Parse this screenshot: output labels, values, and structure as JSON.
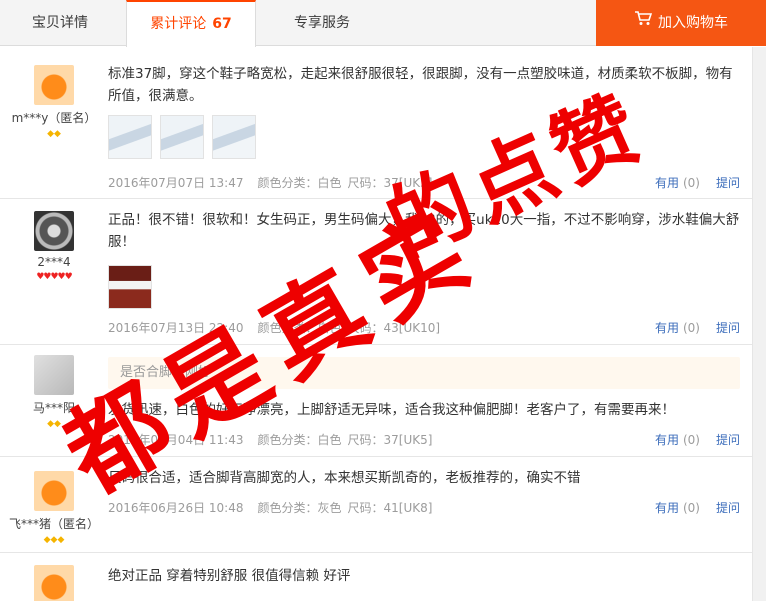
{
  "tabs": {
    "detail": "宝贝详情",
    "reviews_label": "累计评论",
    "reviews_count": "67",
    "service": "专享服务",
    "cart": "加入购物车"
  },
  "reviews": [
    {
      "nick": "m***y（匿名）",
      "rank": "◆◆",
      "text": "标准37脚，穿这个鞋子略宽松，走起来很舒服很轻，很跟脚，没有一点塑胶味道，材质柔软不板脚，物有所值，很满意。",
      "date": "2016年07月07日 13:47",
      "color": "颜色分类：白色",
      "size": "尺码：37[UK5]",
      "useful": "有用",
      "useful_n": "(0)",
      "ask": "提问"
    },
    {
      "nick": "2***4",
      "rank": "♥♥♥♥♥",
      "text": "正品！很不错！很软和！女生码正，男生码偏大，我43的，买uk10大一指，不过不影响穿，涉水鞋偏大舒服！",
      "date": "2016年07月13日 22:40",
      "color": "颜色分类：白色",
      "size": "尺码：43[UK10]",
      "useful": "有用",
      "useful_n": "(0)",
      "ask": "提问"
    },
    {
      "nick": "马***阳",
      "rank": "◆◆",
      "append": "是否合脚：刚好",
      "text": "发货迅速，白色的好干净漂亮，上脚舒适无异味，适合我这种偏肥脚！老客户了，有需要再来！",
      "date": "2016年07月04日 11:43",
      "color": "颜色分类：白色",
      "size": "尺码：37[UK5]",
      "useful": "有用",
      "useful_n": "(0)",
      "ask": "提问"
    },
    {
      "nick": "飞***猪（匿名）",
      "rank": "◆◆◆",
      "text": "尺码很合适，适合脚背高脚宽的人，本来想买斯凯奇的，老板推荐的，确实不错",
      "date": "2016年06月26日 10:48",
      "color": "颜色分类：灰色",
      "size": "尺码：41[UK8]",
      "useful": "有用",
      "useful_n": "(0)",
      "ask": "提问"
    },
    {
      "text": "绝对正品 穿着特别舒服 很值得信赖 好评"
    }
  ],
  "watermark": {
    "line1": "的点赞",
    "line2": "都是真实"
  },
  "icons": {
    "cart": "shopping-cart-icon"
  },
  "colors": {
    "accent": "#f55613",
    "link": "#3c6dbb",
    "watermark": "#ee0000"
  }
}
